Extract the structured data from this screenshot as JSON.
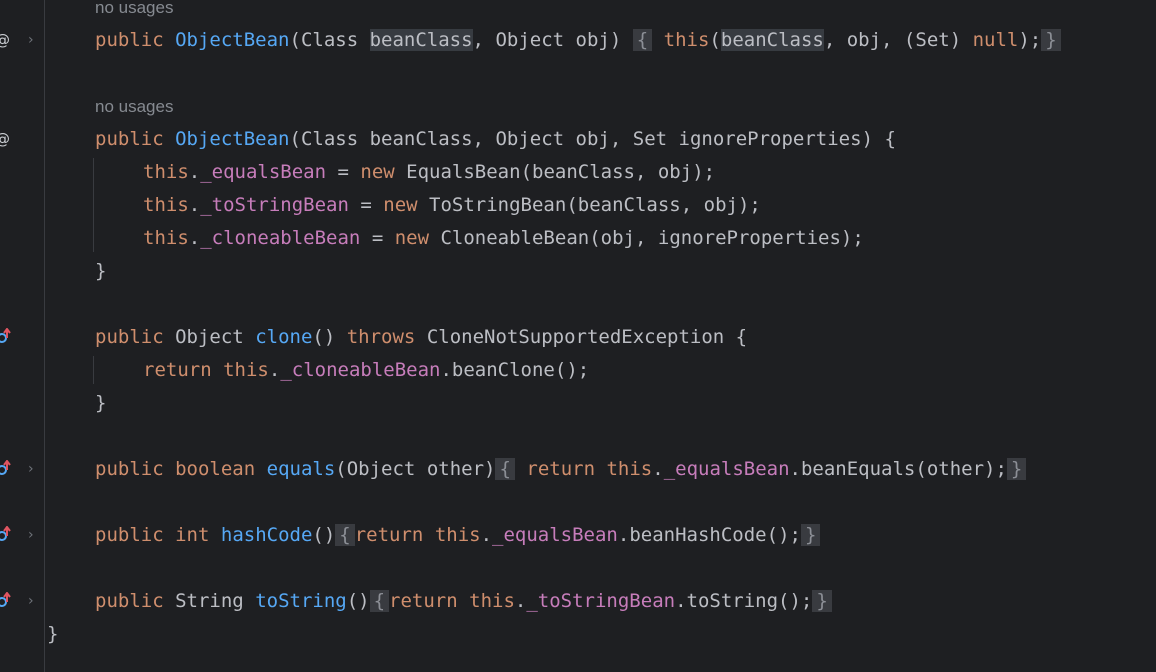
{
  "editor": {
    "hints": [
      "no usages",
      "no usages"
    ],
    "gutter_icons": {
      "implements": "at-sign-icon",
      "overrides": "override-arrow-icon",
      "fold": "chevron-right-icon"
    },
    "tokens": {
      "public": "public",
      "object_bean": "ObjectBean",
      "class_kw": "Class",
      "bean_class": "beanClass",
      "object_type": "Object",
      "obj": "obj",
      "this_kw": "this",
      "set_type": "Set",
      "null_kw": "null",
      "ignore_props": "ignoreProperties",
      "new_kw": "new",
      "equals_bean_field": "_equalsBean",
      "tostring_bean_field": "_toStringBean",
      "cloneable_bean_field": "_cloneableBean",
      "equals_bean_cls": "EqualsBean",
      "tostring_bean_cls": "ToStringBean",
      "cloneable_bean_cls": "CloneableBean",
      "clone_fn": "clone",
      "throws_kw": "throws",
      "clone_ex": "CloneNotSupportedException",
      "return_kw": "return",
      "bean_clone": "beanClone",
      "boolean_kw": "boolean",
      "equals_fn": "equals",
      "other": "other",
      "bean_equals": "beanEquals",
      "int_kw": "int",
      "hashcode_fn": "hashCode",
      "bean_hashcode": "beanHashCode",
      "string_type": "String",
      "tostring_fn": "toString"
    }
  }
}
